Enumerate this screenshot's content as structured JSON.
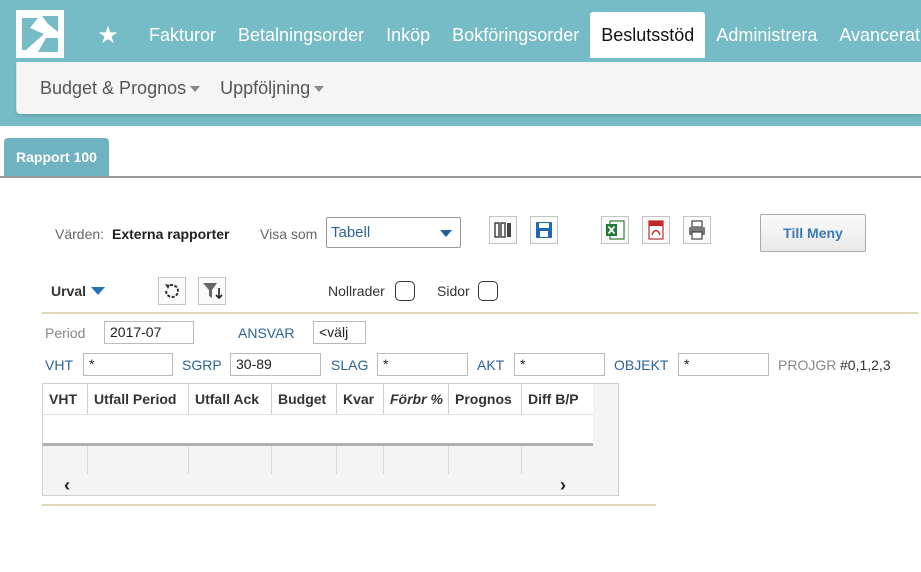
{
  "nav": {
    "items": [
      "Fakturor",
      "Betalningsorder",
      "Inköp",
      "Bokföringsorder",
      "Beslutsstöd",
      "Administrera",
      "Avancerat"
    ],
    "active": "Beslutsstöd"
  },
  "subnav": {
    "budget_label": "Budget & Prognos",
    "uppfoljning_label": "Uppföljning"
  },
  "tab": {
    "label": "Rapport 100"
  },
  "toolbar": {
    "varden_label": "Värden:",
    "varden_value": "Externa rapporter",
    "visa_som_label": "Visa som",
    "visa_som_value": "Tabell",
    "menu_button": "Till Meny"
  },
  "filters": {
    "urval_label": "Urval",
    "nollrader_label": "Nollrader",
    "sidor_label": "Sidor",
    "period_label": "Period",
    "period_value": "2017-07",
    "ansvar_label": "ANSVAR",
    "ansvar_value": "<välj",
    "vht_label": "VHT",
    "vht_value": "*",
    "sgrp_label": "SGRP",
    "sgrp_value": "30-89",
    "slag_label": "SLAG",
    "slag_value": "*",
    "akt_label": "AKT",
    "akt_value": "*",
    "objekt_label": "OBJEKT",
    "objekt_value": "*",
    "projgr_label": "PROJGR",
    "projgr_value": "#0,1,2,3"
  },
  "table": {
    "columns": [
      "VHT",
      "Utfall Period",
      "Utfall Ack",
      "Budget",
      "Kvar",
      "Förbr %",
      "Prognos",
      "Diff B/P"
    ]
  },
  "colors": {
    "header_bg": "#76bcc6",
    "tab_bg": "#6fb3c0",
    "accent_blue": "#2a6496"
  }
}
